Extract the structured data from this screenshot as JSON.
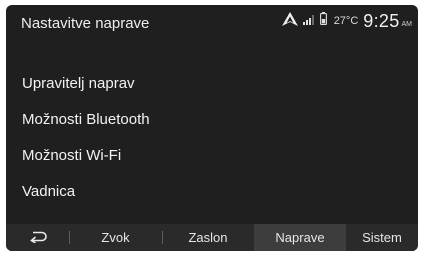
{
  "header": {
    "title": "Nastavitve naprave",
    "status": {
      "temperature": "27°C",
      "time": "9:25",
      "ampm": "AM",
      "icons": [
        "android-auto-icon",
        "signal-bars-icon",
        "battery-icon"
      ]
    }
  },
  "menu": {
    "items": [
      {
        "label": "Upravitelj naprav"
      },
      {
        "label": "Možnosti Bluetooth"
      },
      {
        "label": "Možnosti Wi-Fi"
      },
      {
        "label": "Vadnica"
      }
    ]
  },
  "tabbar": {
    "back_icon": "back-arrow-icon",
    "tabs": [
      {
        "label": "Zvok"
      },
      {
        "label": "Zaslon"
      },
      {
        "label": "Naprave"
      },
      {
        "label": "Sistem"
      }
    ],
    "active_tab": "Naprave"
  },
  "colors": {
    "background": "#1f1f1f",
    "tabbar": "#2a2a2a",
    "active_tab": "#3d3d3d",
    "text": "#f2f2f2"
  }
}
